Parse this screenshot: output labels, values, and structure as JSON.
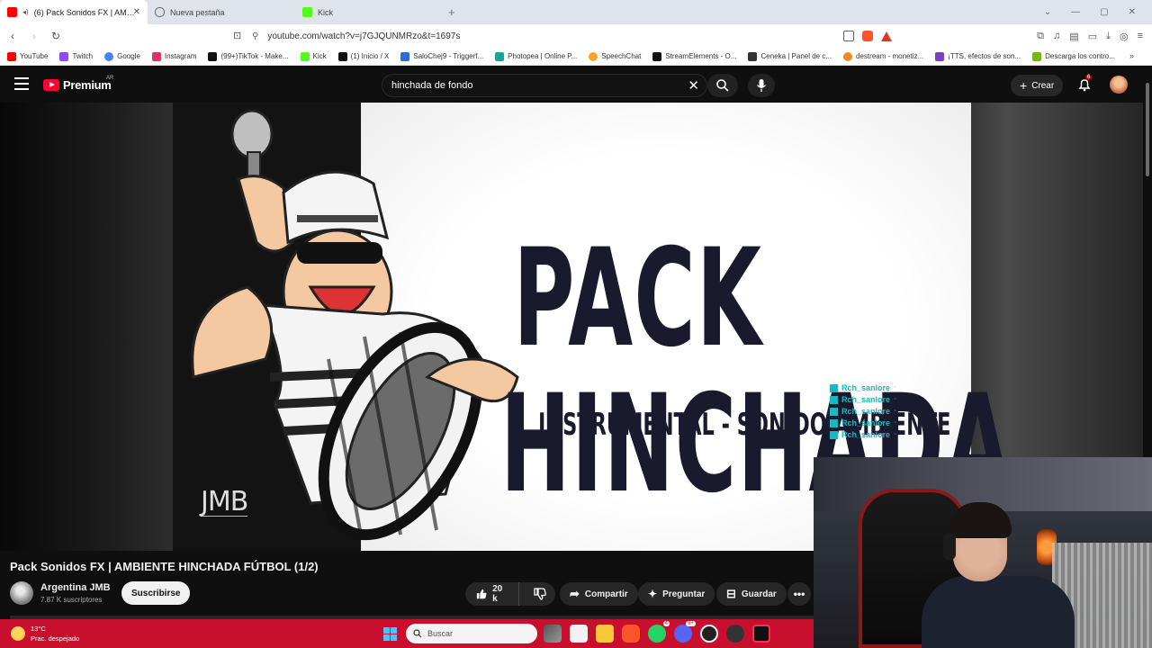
{
  "browser": {
    "tabs": [
      {
        "label": "(6) Pack Sonidos FX | AMBIENTE HINCHADA FÚTBOL (1/2)",
        "active": true,
        "favicon": "youtube-icon"
      },
      {
        "label": "Nueva pestaña",
        "active": false,
        "favicon": "shield-icon"
      },
      {
        "label": "Kick",
        "active": false,
        "favicon": "kick-icon"
      }
    ],
    "url": "youtube.com/watch?v=j7GJQUNMRzo&t=1697s",
    "bookmarks": [
      {
        "label": "YouTube",
        "color": "#ff0000"
      },
      {
        "label": "Twitch",
        "color": "#9146ff"
      },
      {
        "label": "Google",
        "color": "#4285f4"
      },
      {
        "label": "Instagram",
        "color": "#e1306c"
      },
      {
        "label": "(99+)TikTok - Make...",
        "color": "#111111"
      },
      {
        "label": "Kick",
        "color": "#53fc18"
      },
      {
        "label": "(1) Inicio / X",
        "color": "#111111"
      },
      {
        "label": "SaloChej9 - Triggerf...",
        "color": "#2b6cd9"
      },
      {
        "label": "Photopea | Online P...",
        "color": "#18a497"
      },
      {
        "label": "SpeechChat",
        "color": "#f5a623"
      },
      {
        "label": "StreamElements - O...",
        "color": "#111111"
      },
      {
        "label": "Ceneka | Panel de c...",
        "color": "#333333"
      },
      {
        "label": "destream - monetiz...",
        "color": "#f08c1f"
      },
      {
        "label": "¡TTS, efectos de son...",
        "color": "#7b3fbf"
      },
      {
        "label": "Descarga los contro...",
        "color": "#76b900"
      }
    ],
    "bookmarks_more": "»"
  },
  "youtube": {
    "brand": "Premium",
    "country": "AR",
    "search_value": "hinchada de fondo",
    "create_label": "Crear",
    "notif_count": "6"
  },
  "thumbnail": {
    "line1": "PACK",
    "line2": "HINCHADA",
    "subtitle": "INSTRUMENTAL - SONIDO AMBIENTE",
    "watermark": "JMB",
    "chat_user": "Rch_sanlore"
  },
  "video": {
    "title": "Pack Sonidos FX | AMBIENTE HINCHADA FÚTBOL (1/2)",
    "channel": "Argentina JMB",
    "subscribers": "7.87 K suscriptores",
    "subscribe_label": "Suscribirse",
    "likes": "20 k",
    "share_label": "Compartir",
    "ask_label": "Preguntar",
    "save_label": "Guardar"
  },
  "taskbar": {
    "temp": "13°C",
    "condition": "Prac. despejado",
    "search_label": "Buscar",
    "whatsapp_badge": "4",
    "discord_badge": "9+"
  },
  "colors": {
    "accent": "#ff0033",
    "taskbar": "#c8102e",
    "chat": "#19b8c0"
  }
}
